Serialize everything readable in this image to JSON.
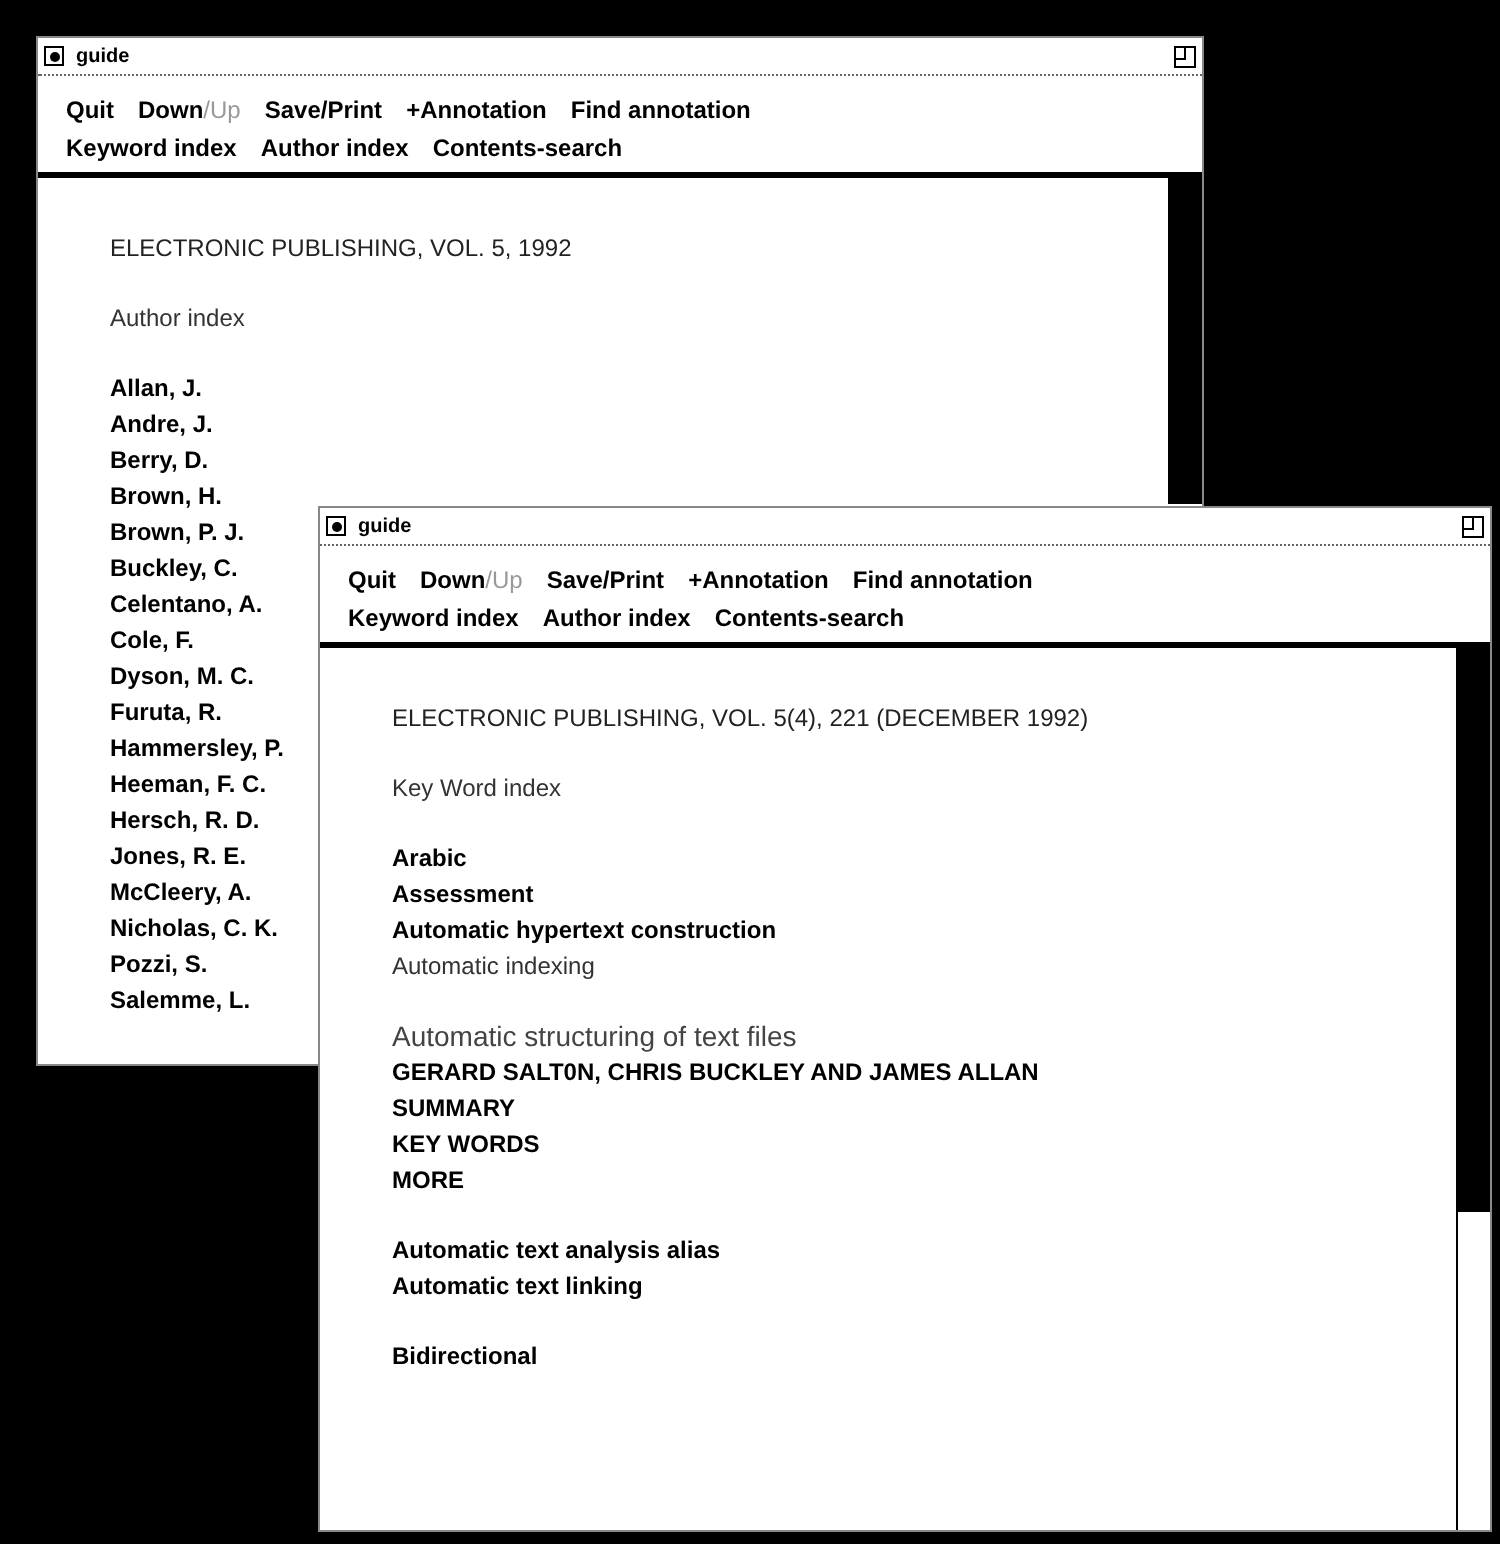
{
  "windows": [
    {
      "title": "guide",
      "menu_rows": [
        [
          {
            "parts": [
              {
                "text": "Quit",
                "disabled": false
              }
            ]
          },
          {
            "parts": [
              {
                "text": "Down",
                "disabled": false
              },
              {
                "text": "/Up",
                "disabled": true
              }
            ]
          },
          {
            "parts": [
              {
                "text": "Save/Print",
                "disabled": false
              }
            ]
          },
          {
            "parts": [
              {
                "text": "+Annotation",
                "disabled": false
              }
            ]
          },
          {
            "parts": [
              {
                "text": "Find annotation",
                "disabled": false
              }
            ]
          }
        ],
        [
          {
            "parts": [
              {
                "text": "Keyword index",
                "disabled": false
              }
            ]
          },
          {
            "parts": [
              {
                "text": "Author index",
                "disabled": false
              }
            ]
          },
          {
            "parts": [
              {
                "text": "Contents-search",
                "disabled": false
              }
            ]
          }
        ]
      ],
      "lines": [
        {
          "kind": "heading",
          "text": "ELECTRONIC PUBLISHING, VOL. 5, 1992"
        },
        {
          "kind": "gap"
        },
        {
          "kind": "plain",
          "text": "Author index"
        },
        {
          "kind": "gap"
        },
        {
          "kind": "link",
          "text": "Allan, J."
        },
        {
          "kind": "link",
          "text": "Andre, J."
        },
        {
          "kind": "link",
          "text": "Berry, D."
        },
        {
          "kind": "link",
          "text": "Brown, H."
        },
        {
          "kind": "link",
          "text": "Brown, P. J."
        },
        {
          "kind": "link",
          "text": "Buckley, C."
        },
        {
          "kind": "link",
          "text": "Celentano, A."
        },
        {
          "kind": "link",
          "text": "Cole, F."
        },
        {
          "kind": "link",
          "text": "Dyson, M. C."
        },
        {
          "kind": "link",
          "text": "Furuta, R."
        },
        {
          "kind": "link",
          "text": "Hammersley, P."
        },
        {
          "kind": "link",
          "text": "Heeman, F. C."
        },
        {
          "kind": "link",
          "text": "Hersch, R. D."
        },
        {
          "kind": "link",
          "text": "Jones, R. E."
        },
        {
          "kind": "link",
          "text": "McCleery, A."
        },
        {
          "kind": "link",
          "text": "Nicholas, C. K."
        },
        {
          "kind": "link",
          "text": "Pozzi, S."
        },
        {
          "kind": "link",
          "text": "Salemme, L."
        }
      ]
    },
    {
      "title": "guide",
      "menu_rows": [
        [
          {
            "parts": [
              {
                "text": "Quit",
                "disabled": false
              }
            ]
          },
          {
            "parts": [
              {
                "text": "Down",
                "disabled": false
              },
              {
                "text": "/Up",
                "disabled": true
              }
            ]
          },
          {
            "parts": [
              {
                "text": "Save/Print",
                "disabled": false
              }
            ]
          },
          {
            "parts": [
              {
                "text": "+Annotation",
                "disabled": false
              }
            ]
          },
          {
            "parts": [
              {
                "text": "Find annotation",
                "disabled": false
              }
            ]
          }
        ],
        [
          {
            "parts": [
              {
                "text": "Keyword index",
                "disabled": false
              }
            ]
          },
          {
            "parts": [
              {
                "text": "Author index",
                "disabled": false
              }
            ]
          },
          {
            "parts": [
              {
                "text": "Contents-search",
                "disabled": false
              }
            ]
          }
        ]
      ],
      "lines": [
        {
          "kind": "heading",
          "text": "ELECTRONIC PUBLISHING, VOL. 5(4), 221 (DECEMBER 1992)"
        },
        {
          "kind": "gap"
        },
        {
          "kind": "plain",
          "text": "Key Word index"
        },
        {
          "kind": "gap"
        },
        {
          "kind": "link",
          "text": "Arabic"
        },
        {
          "kind": "link",
          "text": "Assessment"
        },
        {
          "kind": "link",
          "text": "Automatic hypertext construction"
        },
        {
          "kind": "plain",
          "text": "Automatic indexing"
        },
        {
          "kind": "gap"
        },
        {
          "kind": "subtitle",
          "text": "Automatic structuring of text files"
        },
        {
          "kind": "caps",
          "text": "GERARD SALT0N, CHRIS BUCKLEY AND JAMES ALLAN"
        },
        {
          "kind": "caps",
          "text": "SUMMARY"
        },
        {
          "kind": "caps",
          "text": "KEY WORDS"
        },
        {
          "kind": "caps",
          "text": "MORE"
        },
        {
          "kind": "gap"
        },
        {
          "kind": "link",
          "text": "Automatic text analysis alias"
        },
        {
          "kind": "link",
          "text": "Automatic text linking"
        },
        {
          "kind": "gap"
        },
        {
          "kind": "link",
          "text": "Bidirectional"
        }
      ]
    }
  ]
}
